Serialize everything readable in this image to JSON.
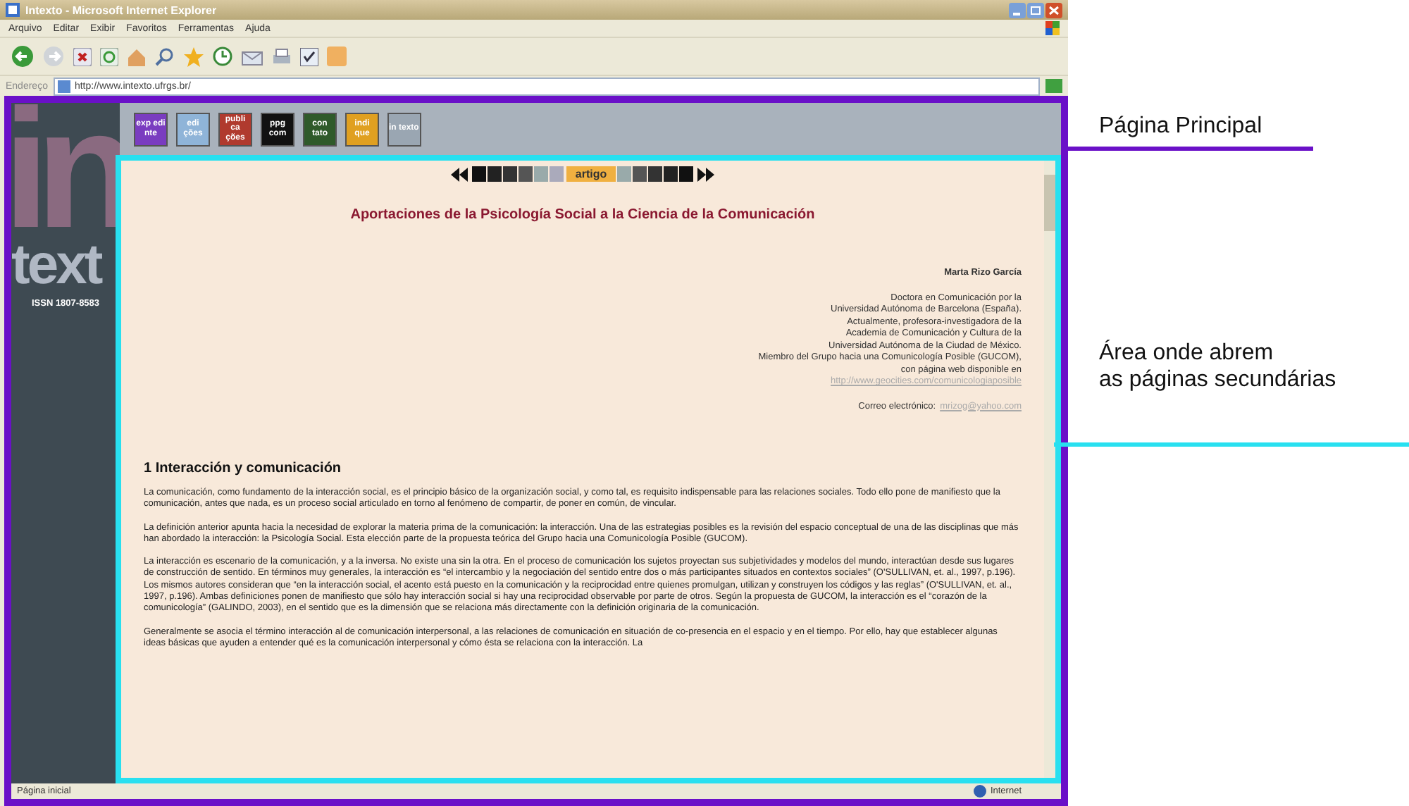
{
  "window": {
    "title": "Intexto - Microsoft Internet Explorer"
  },
  "menu": [
    "Arquivo",
    "Editar",
    "Exibir",
    "Favoritos",
    "Ferramentas",
    "Ajuda"
  ],
  "address": {
    "label": "Endereço",
    "value": "http://www.intexto.ufrgs.br/"
  },
  "sidebar": {
    "logo_top": "in",
    "logo_bottom": "text",
    "issn": "ISSN 1807-8583"
  },
  "nav_icons": [
    {
      "label": "exp edi nte",
      "color": "#7a3cc0"
    },
    {
      "label": "edi ções",
      "color": "#8fb4d8"
    },
    {
      "label": "publi ca ções",
      "color": "#b03a2e"
    },
    {
      "label": "ppg com",
      "color": "#111111"
    },
    {
      "label": "con tato",
      "color": "#2f5a2a"
    },
    {
      "label": "indi que",
      "color": "#e0a020"
    },
    {
      "label": "in texto",
      "color": "#9aa6b2"
    }
  ],
  "article_nav": {
    "label": "artigo"
  },
  "article": {
    "title": "Aportaciones de la Psicología Social a la Ciencia de la Comunicación",
    "author": "Marta Rizo García",
    "bio": [
      "Doctora en Comunicación por la",
      "Universidad Autónoma de Barcelona (España).",
      "Actualmente, profesora-investigadora de la",
      "Academia de Comunicación y Cultura de la",
      "Universidad Autónoma de la Ciudad de México.",
      "Miembro del Grupo hacia una Comunicología Posible (GUCOM),",
      "con página web disponible en"
    ],
    "website": "http://www.geocities.com/comunicologiaposible",
    "email_label": "Correo electrónico:",
    "email": "mrizog@yahoo.com",
    "section": "1 Interacción y comunicación",
    "paragraphs": [
      "La comunicación, como fundamento de la interacción social, es el principio básico de la organización social, y como tal, es requisito indispensable para las relaciones sociales. Todo ello pone de manifiesto que la comunicación, antes que nada, es un proceso social articulado en torno al fenómeno de compartir, de poner en común, de vincular.",
      "La definición anterior apunta hacia la necesidad de explorar la materia prima de la comunicación: la interacción. Una de las estrategias posibles es la revisión del espacio conceptual de una de las disciplinas que más han abordado la interacción: la Psicología Social. Esta elección parte de la propuesta teórica del Grupo hacia una Comunicología Posible (GUCOM).",
      "La interacción es escenario de la comunicación, y a la inversa. No existe una sin la otra. En el proceso de comunicación los sujetos proyectan sus subjetividades y modelos del mundo, interactúan desde sus lugares de construcción de sentido. En términos muy generales, la interacción es “el intercambio y la negociación del sentido entre dos o más participantes situados en contextos sociales” (O'SULLIVAN, et. al., 1997, p.196). Los mismos autores consideran que “en la interacción social, el acento está puesto en la comunicación y la reciprocidad entre quienes promulgan, utilizan y construyen los códigos y las reglas” (O'SULLIVAN, et. al., 1997, p.196). Ambas definiciones ponen de manifiesto que sólo hay interacción social si hay una reciprocidad observable por parte de otros. Según la propuesta de GUCOM, la interacción es el “corazón de la comunicología” (GALINDO, 2003), en el sentido que es la dimensión que se relaciona más directamente con la definición originaria de la comunicación.",
      "Generalmente se asocia el término interacción al de comunicación interpersonal, a las relaciones de comunicación en situación de co-presencia en el espacio y en el tiempo. Por ello, hay que establecer algunas ideas básicas que ayuden a entender qué es la comunicación interpersonal y cómo ésta se relaciona con la interacción. La"
    ]
  },
  "status_bar": {
    "left": "Página inicial",
    "right": "Internet"
  },
  "annotations": [
    {
      "text": "Página Principal",
      "kind": "main"
    },
    {
      "text": "Área onde abrem",
      "kind": "secondary"
    },
    {
      "text": "as páginas secundárias",
      "kind": "secondary"
    }
  ]
}
